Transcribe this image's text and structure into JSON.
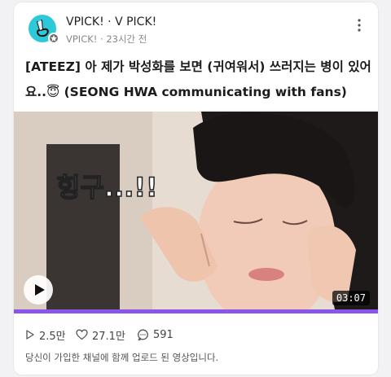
{
  "post": {
    "channel_name": "VPICK! · V PICK!",
    "channel_sub": "VPICK! · 23시간 전",
    "title": "[ATEEZ] 아 제가 박성화를 보면 (귀여워서) 쓰러지는 병이 있어요..😇 (SEONG HWA communicating with fans)"
  },
  "video": {
    "duration": "03:07",
    "progress": 1.0,
    "caption_overlay": "힝구...!!"
  },
  "stats": {
    "views": "2.5만",
    "likes": "27.1만",
    "comments": "591"
  },
  "notice": "당신이 가입한 채널에 함께 업로드 된 영상입니다.",
  "icons": {
    "avatar": "v-hand-icon",
    "badge": "star-badge-icon",
    "more": "more-vertical-icon",
    "play": "play-icon",
    "views": "play-outline-icon",
    "likes": "heart-outline-icon",
    "comments": "comment-icon"
  },
  "colors": {
    "avatar_bg": "#2ec9d8",
    "progress": "#8a55e8"
  }
}
